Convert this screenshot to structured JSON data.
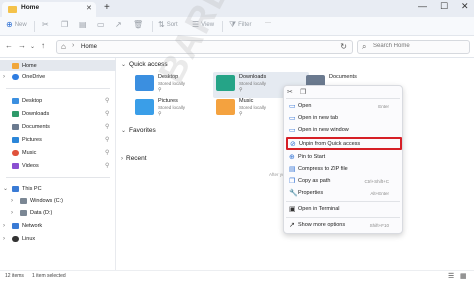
{
  "window": {
    "tab_title": "Home",
    "tab_close": "✕",
    "new_tab": "+",
    "minimize": "—",
    "maximize": "☐",
    "close": "✕"
  },
  "toolbar": {
    "new_label": "New",
    "sort_label": "Sort",
    "view_label": "View",
    "filter_label": "Filter",
    "more": "···"
  },
  "navbar": {
    "back": "←",
    "forward": "→",
    "up": "↑",
    "breadcrumb": "Home",
    "search_placeholder": "Search Home"
  },
  "sidebar": {
    "items": [
      {
        "label": "Home",
        "color": "#f0a63a"
      },
      {
        "label": "OneDrive",
        "color": "#2f7de1"
      },
      {
        "label": "Desktop",
        "color": "#3b8fe0"
      },
      {
        "label": "Downloads",
        "color": "#2e9a6a"
      },
      {
        "label": "Documents",
        "color": "#6b7a8f"
      },
      {
        "label": "Pictures",
        "color": "#2b86d9"
      },
      {
        "label": "Music",
        "color": "#e0523b"
      },
      {
        "label": "Videos",
        "color": "#8a4fd1"
      },
      {
        "label": "This PC",
        "color": "#3a7bd5"
      },
      {
        "label": "Windows (C:)",
        "color": "#7b8794"
      },
      {
        "label": "Data (D:)",
        "color": "#7b8794"
      },
      {
        "label": "Network",
        "color": "#3a7bd5"
      },
      {
        "label": "Linux",
        "color": "#333333"
      }
    ]
  },
  "content": {
    "quick_access_label": "Quick access",
    "favorites_label": "Favorites",
    "recent_label": "Recent",
    "empty_note": "After you pinne",
    "quick_items": [
      {
        "name": "Desktop",
        "sub": "Stored locally",
        "color": "#3b8fe0"
      },
      {
        "name": "Downloads",
        "sub": "Stored locally",
        "color": "#25a487"
      },
      {
        "name": "Documents",
        "sub": "",
        "color": "#6b7a8f"
      },
      {
        "name": "Pictures",
        "sub": "Stored locally",
        "color": "#3a9ee8"
      },
      {
        "name": "Music",
        "sub": "Stored locally",
        "color": "#f4a23f"
      }
    ]
  },
  "context_menu": {
    "items": [
      {
        "label": "Open",
        "shortcut": "Enter",
        "icon": "folder-open-icon",
        "glyph": "▭"
      },
      {
        "label": "Open in new tab",
        "shortcut": "",
        "icon": "new-tab-icon",
        "glyph": "▭"
      },
      {
        "label": "Open in new window",
        "shortcut": "",
        "icon": "new-window-icon",
        "glyph": "▭"
      },
      {
        "label": "Unpin from Quick access",
        "shortcut": "",
        "icon": "unpin-icon",
        "glyph": "⊘"
      },
      {
        "label": "Pin to Start",
        "shortcut": "",
        "icon": "pin-icon",
        "glyph": "⊕"
      },
      {
        "label": "Compress to ZIP file",
        "shortcut": "",
        "icon": "zip-icon",
        "glyph": "▤"
      },
      {
        "label": "Copy as path",
        "shortcut": "Ctrl+Shift+C",
        "icon": "copy-path-icon",
        "glyph": "❐"
      },
      {
        "label": "Properties",
        "shortcut": "Alt+Enter",
        "icon": "properties-icon",
        "glyph": "🔧"
      },
      {
        "label": "Open in Terminal",
        "shortcut": "",
        "icon": "terminal-icon",
        "glyph": "▣"
      },
      {
        "label": "Show more options",
        "shortcut": "Shift+F10",
        "icon": "more-options-icon",
        "glyph": "↗"
      }
    ],
    "highlight_color": "#d61f26"
  },
  "watermark": "BARDIMIN",
  "status": {
    "item_count": "12 items",
    "selection": "1 item selected"
  },
  "accent": "#2d6fd3"
}
